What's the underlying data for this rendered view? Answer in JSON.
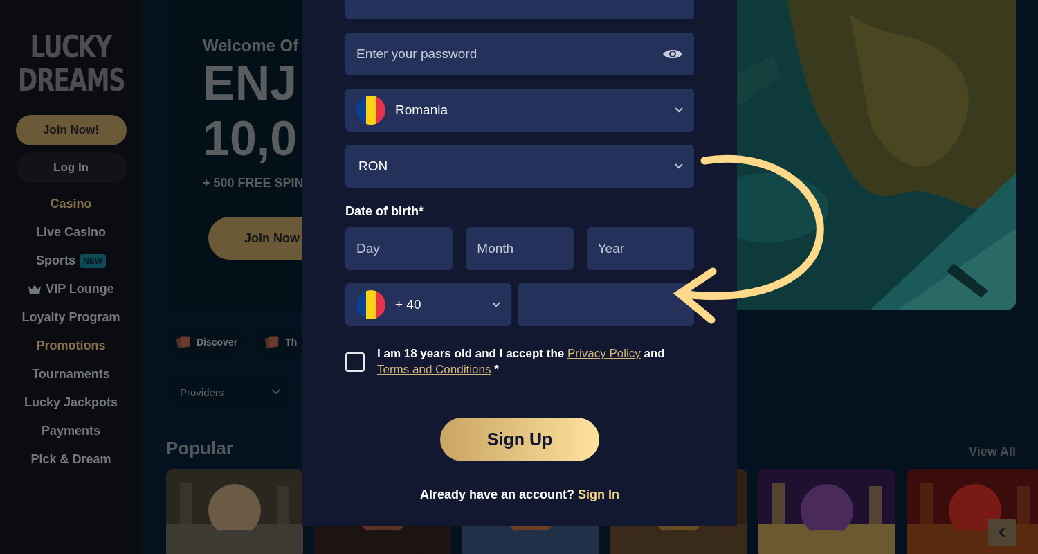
{
  "sidebar": {
    "logo": [
      "LUCKY",
      "DREAMS"
    ],
    "join_button": "Join Now!",
    "login_button": "Log In",
    "nav": [
      {
        "label": "Casino",
        "kind": "text",
        "highlighted": true
      },
      {
        "label": "Live Casino",
        "kind": "text",
        "highlighted": false
      },
      {
        "label": "Sports",
        "kind": "text",
        "highlighted": false,
        "badge": "NEW"
      },
      {
        "label": "VIP Lounge",
        "kind": "crown",
        "highlighted": false
      },
      {
        "label": "Loyalty Program",
        "kind": "text",
        "highlighted": false
      },
      {
        "label": "Promotions",
        "kind": "text",
        "highlighted": true
      },
      {
        "label": "Tournaments",
        "kind": "text",
        "highlighted": false
      },
      {
        "label": "Lucky Jackpots",
        "kind": "text",
        "highlighted": false
      },
      {
        "label": "Payments",
        "kind": "text",
        "highlighted": false
      },
      {
        "label": "Pick & Dream",
        "kind": "text",
        "highlighted": false
      }
    ]
  },
  "hero": {
    "welcome": "Welcome Of",
    "headline": [
      "ENJ",
      "10,0"
    ],
    "subline": "+ 500 FREE SPIN",
    "button": "Join Now",
    "kind": "picture"
  },
  "chips": [
    {
      "label": "Discover"
    },
    {
      "label": "Th"
    }
  ],
  "filters": [
    {
      "label": "Providers"
    }
  ],
  "section": {
    "title": "Popular",
    "link": "View All"
  },
  "form": {
    "password": {
      "placeholder": "Enter your password"
    },
    "country": {
      "value": "Romania"
    },
    "currency": {
      "value": "RON"
    },
    "dob": {
      "label": "Date of birth*",
      "fields": [
        {
          "placeholder": "Day"
        },
        {
          "placeholder": "Month"
        },
        {
          "placeholder": "Year"
        }
      ]
    },
    "phone": {
      "code": "+ 40"
    },
    "consent": {
      "checked": false,
      "text": "I am 18 years old and I accept the",
      "link1": "Privacy Policy",
      "middle": "and",
      "link2": "Terms and Conditions",
      "suffix": "*"
    },
    "submit": "Sign Up",
    "footer": {
      "text": "Already have an account?",
      "link": "Sign In"
    }
  }
}
